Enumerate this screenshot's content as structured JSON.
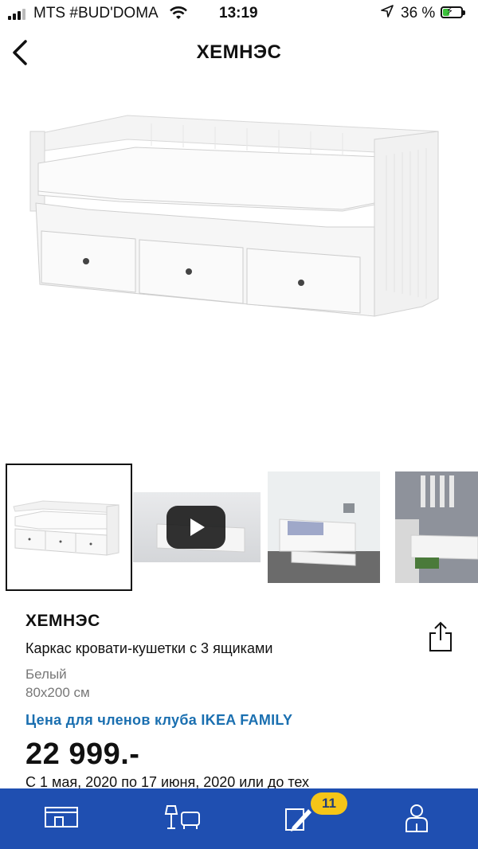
{
  "status_bar": {
    "carrier": "MTS #BUD'DOMA",
    "time": "13:19",
    "battery_percent": "36 %",
    "battery_level": 0.36,
    "icons": [
      "signal-icon",
      "wifi-icon",
      "location-arrow-icon",
      "battery-charging-icon"
    ]
  },
  "nav": {
    "title": "ХЕМНЭС",
    "back_icon": "chevron-left-icon"
  },
  "gallery": {
    "selected_index": 0,
    "thumbnails": [
      "product-photo",
      "video",
      "room-photo",
      "room-photo"
    ],
    "play_icon": "play-icon"
  },
  "product": {
    "name": "ХЕМНЭС",
    "description": "Каркас кровати-кушетки с 3 ящиками",
    "color": "Белый",
    "size": "80x200 см",
    "family_label": "Цена для членов клуба IKEA FAMILY",
    "price": "22 999.-",
    "offer_text": "С 1 мая, 2020 по 17 июня, 2020 или до тех",
    "share_icon": "share-icon"
  },
  "tab_bar": {
    "tabs": [
      "home-icon",
      "furniture-icon",
      "shopping-list-icon",
      "profile-icon"
    ],
    "badge": "11",
    "background": "#1f4fb1",
    "badge_color": "#f5c518"
  },
  "colors": {
    "accent": "#1a6fb0"
  }
}
